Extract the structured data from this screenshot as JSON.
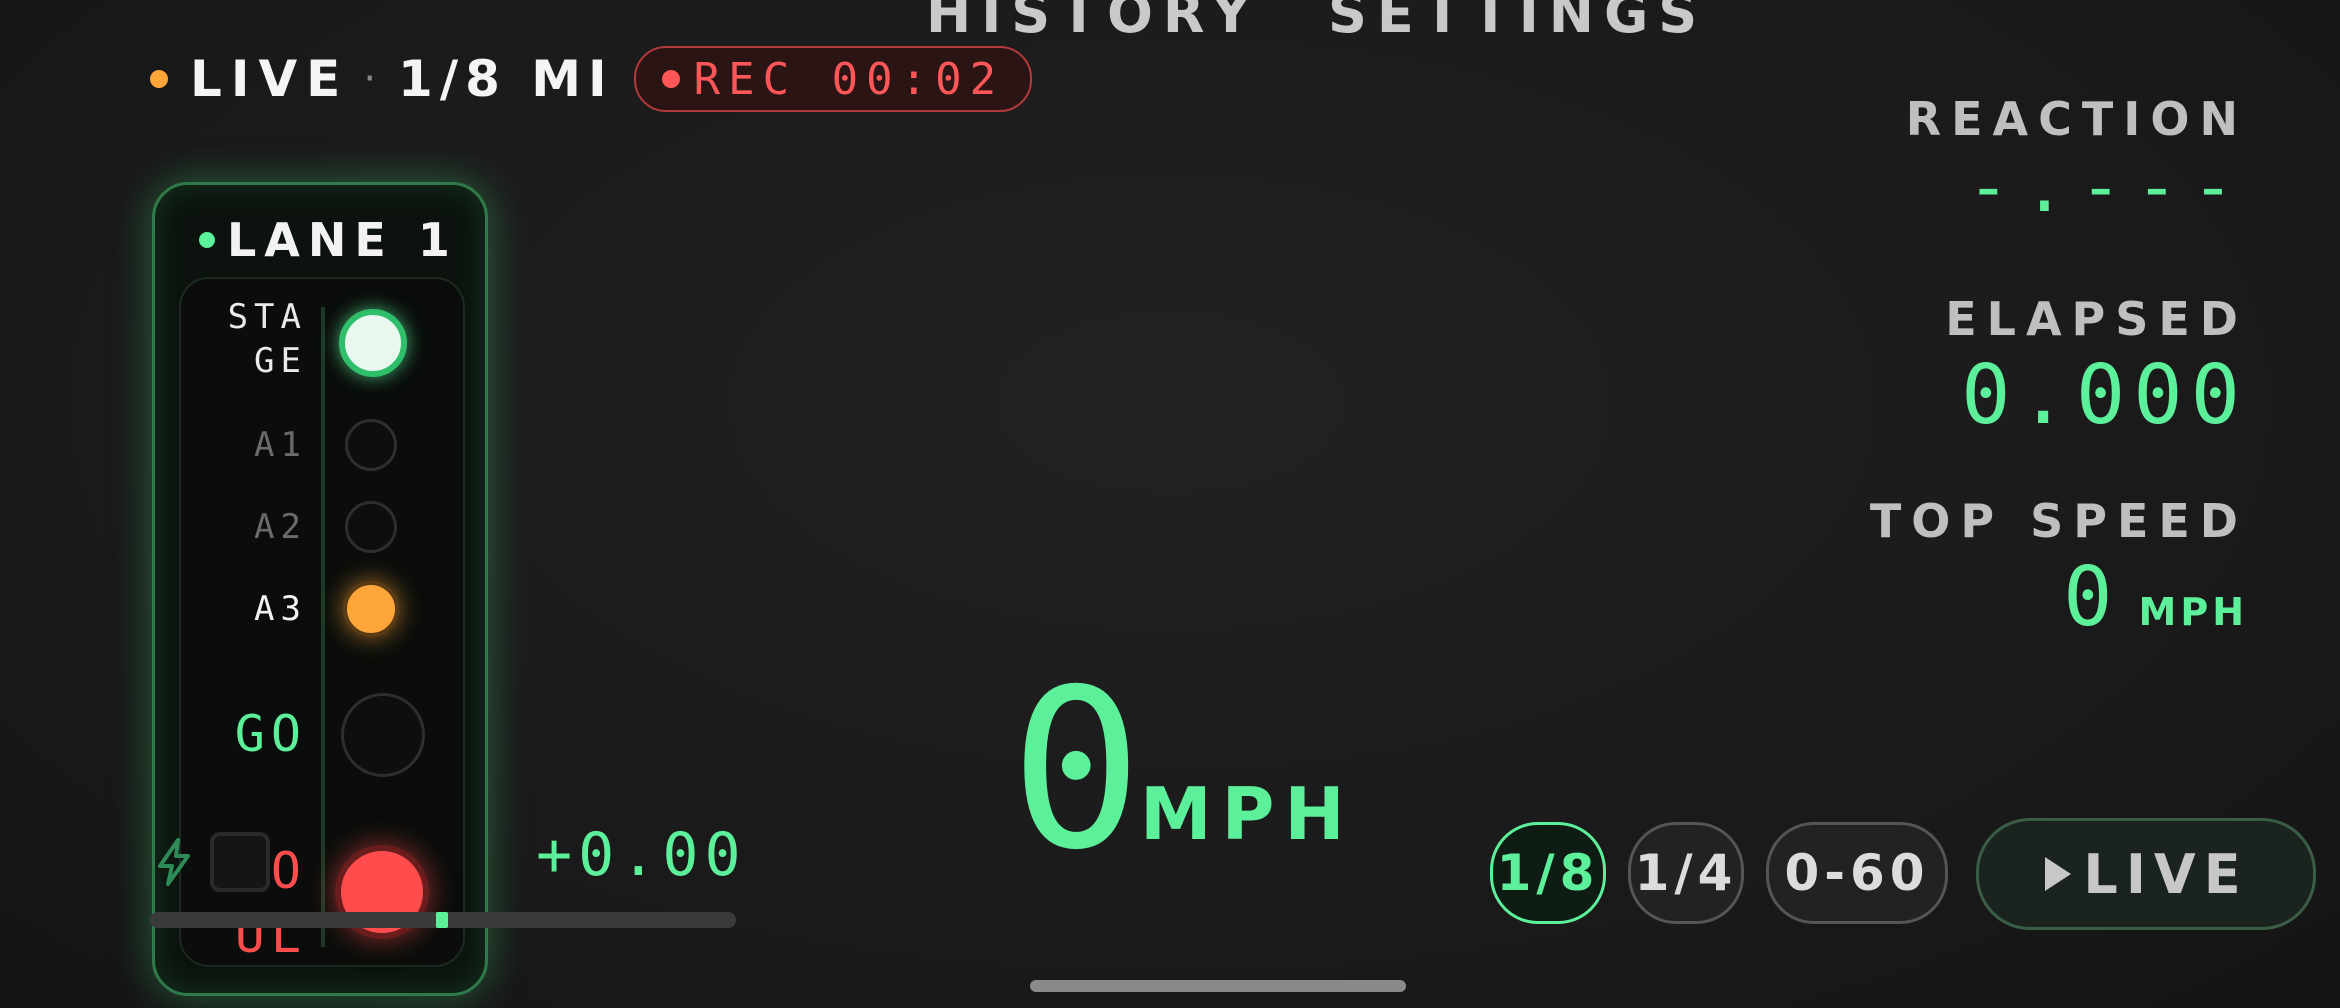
{
  "tabs": {
    "history": "HISTORY",
    "settings": "SETTINGS"
  },
  "status": {
    "mode": "LIVE",
    "separator": "·",
    "distance": "1/8 MI",
    "rec_time": "REC 00:02"
  },
  "lane": {
    "title": "LANE 1",
    "lights": [
      {
        "label": "STA\nGE",
        "state": "on",
        "color": "#e9f7ef"
      },
      {
        "label": "A1",
        "state": "off"
      },
      {
        "label": "A2",
        "state": "off"
      },
      {
        "label": "A3",
        "state": "on",
        "color": "#ffa63a"
      },
      {
        "label": "GO",
        "state": "off"
      },
      {
        "label": "FO\nUL",
        "state": "on",
        "color": "#ff4d4d"
      }
    ]
  },
  "speed": {
    "value": "0",
    "unit": "MPH"
  },
  "stats": {
    "reaction_label": "REACTION",
    "reaction_value": "-.---",
    "elapsed_label": "ELAPSED",
    "elapsed_value": "0.000",
    "top_speed_label": "TOP SPEED",
    "top_speed_value": "0",
    "top_speed_unit": "MPH"
  },
  "delta": "+0.00",
  "modes": {
    "eighth": "1/8",
    "quarter": "1/4",
    "zero_sixty": "0-60",
    "selected": "1/8"
  },
  "live_button": "LIVE",
  "colors": {
    "accent": "#5df09a",
    "record": "#ff5757",
    "amber": "#ffa63a"
  }
}
